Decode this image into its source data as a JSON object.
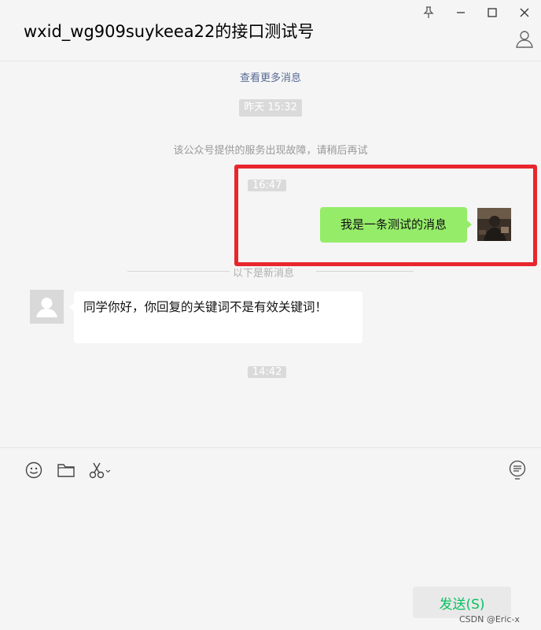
{
  "window": {
    "title": "wxid_wg909suykeea22的接口测试号",
    "controls": [
      "pin-icon",
      "minimize-icon",
      "maximize-icon",
      "close-icon"
    ]
  },
  "messages": {
    "load_more": "查看更多消息",
    "time_yesterday": "昨天  15:32",
    "service_notice": "该公众号提供的服务出现故障，请稍后再试",
    "time_sent": "16:47",
    "outgoing_text": "我是一条测试的消息",
    "new_divider": "以下是新消息",
    "incoming_text": "同学你好，你回复的关键词不是有效关键词！",
    "time_latest": "14:42"
  },
  "toolbar": {
    "icons": [
      "emoji-icon",
      "folder-icon",
      "scissors-icon",
      "chat-history-icon"
    ]
  },
  "compose": {
    "value": "",
    "send_label": "发送(S)"
  },
  "watermark": "CSDN @Eric-x",
  "colors": {
    "outgoing_bubble": "#95ec69",
    "send_text": "#07c160",
    "link": "#576b95",
    "highlight": "#e8262d"
  }
}
